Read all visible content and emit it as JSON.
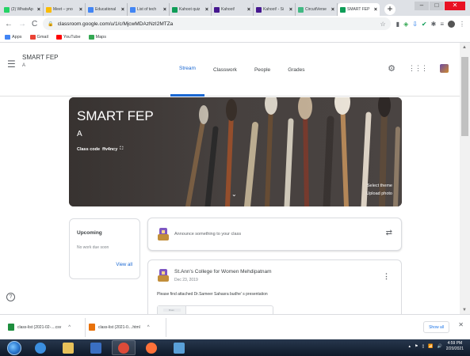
{
  "browser": {
    "tabs": [
      {
        "title": "(2) WhatsAp",
        "color": "#25d366"
      },
      {
        "title": "Meet – yno",
        "color": "#fbbc04"
      },
      {
        "title": "Educational",
        "color": "#4285f4"
      },
      {
        "title": "List of tech",
        "color": "#4285f4"
      },
      {
        "title": "Kahoot quiz",
        "color": "#0f9d58"
      },
      {
        "title": "Kahoot!",
        "color": "#46178f"
      },
      {
        "title": "Kahoot! - Si",
        "color": "#46178f"
      },
      {
        "title": "CircuitVerse",
        "color": "#42b983"
      },
      {
        "title": "SMART FEP",
        "color": "#0f9d58"
      }
    ],
    "new_tab": "+",
    "window_controls": {
      "minimize": "–",
      "maximize": "□",
      "close": "✕"
    },
    "back": "←",
    "forward": "→",
    "reload": "C",
    "url": "classroom.google.com/u/1/c/MjcwMDAzNzI2MTZa",
    "bookmarks": [
      {
        "label": "Apps",
        "color": "#4285f4"
      },
      {
        "label": "Gmail",
        "color": "#ea4335"
      },
      {
        "label": "YouTube",
        "color": "#ff0000"
      },
      {
        "label": "Maps",
        "color": "#34a853"
      }
    ]
  },
  "classroom": {
    "class_name": "SMART FEP",
    "section": "A",
    "nav_tabs": [
      "Stream",
      "Classwork",
      "People",
      "Grades"
    ],
    "active_tab": "Stream",
    "accent_color": "#1967d2",
    "banner": {
      "title": "SMART FEP",
      "section": "A",
      "class_code_label": "Class code",
      "class_code": "ffv4ncy",
      "select_theme": "Select theme",
      "upload_photo": "Upload photo"
    },
    "upcoming": {
      "title": "Upcoming",
      "empty_text": "No work due soon",
      "view_all": "View all"
    },
    "announce_placeholder": "Announce something to your class",
    "post": {
      "author": "St.Ann's College for Women Mehdipatnam",
      "date": "Dec 23, 2019",
      "body": "Please find attached Dr.Sameer Sahasra budhe' s presentation",
      "attachment_label": "Brain"
    }
  },
  "downloads": {
    "items": [
      {
        "name": "class-list (2021-02-....csv",
        "color": "#1e8e3e"
      },
      {
        "name": "class-list (2021-0....html",
        "color": "#e8710a"
      }
    ],
    "show_all": "Show all",
    "close": "✕"
  },
  "taskbar": {
    "apps": [
      {
        "name": "internet-explorer",
        "color": "#3b8fe0"
      },
      {
        "name": "file-explorer",
        "color": "#e8c25a"
      },
      {
        "name": "media-player",
        "color": "#3a6fc2"
      },
      {
        "name": "chrome",
        "color": "#dd4b39"
      },
      {
        "name": "firefox",
        "color": "#ff7139"
      },
      {
        "name": "photos",
        "color": "#5aa0d8"
      }
    ],
    "time": "4:59 PM",
    "date": "2/20/2021"
  }
}
